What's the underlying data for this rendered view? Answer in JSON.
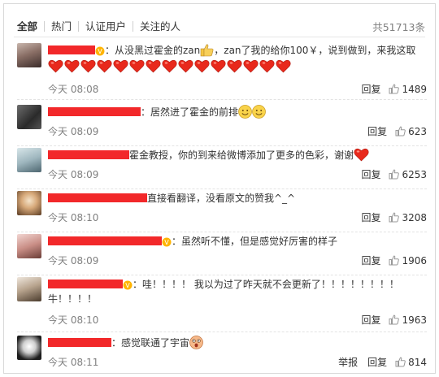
{
  "tabs": [
    "全部",
    "热门",
    "认证用户",
    "关注的人"
  ],
  "total": "共51713条",
  "actions": {
    "report": "举报",
    "reply": "回复"
  },
  "colors": {
    "redaction": "#f2282a",
    "heart": "#e8291c",
    "like_icon": "#999999"
  },
  "comments": [
    {
      "name_redacted": true,
      "pre": "：从没黑过霍金的zan",
      "mid": "，zan了我的给你100￥，说到做到，来我这取",
      "hearts": 15,
      "time": "今天 08:08",
      "likes": "1489",
      "icons": [
        "thumbs-up-emoji",
        "heart-emoji"
      ]
    },
    {
      "name_redacted": true,
      "pre": "：居然进了霍金的前排",
      "time": "今天 08:09",
      "likes": "623",
      "icons": [
        "smile-emoji"
      ]
    },
    {
      "name_redacted": true,
      "pre": "霍金教授，你的到来给微博添加了更多的色彩，谢谢",
      "time": "今天 08:09",
      "likes": "6253",
      "icons": [
        "heart-emoji"
      ]
    },
    {
      "name_redacted": true,
      "pre": "直接看翻译，没看原文的赞我^_^",
      "time": "今天 08:10",
      "likes": "3208"
    },
    {
      "name_redacted": true,
      "pre": "：虽然听不懂，但是感觉好厉害的样子",
      "time": "今天 08:09",
      "likes": "1906"
    },
    {
      "name_redacted": true,
      "pre": "：哇！！！！ 我以为过了昨天就不会更新了！！！！！！！！",
      "line2": "牛！！！！",
      "time": "今天 08:10",
      "likes": "1963"
    },
    {
      "name_redacted": true,
      "pre": "：感觉联通了宇宙",
      "time": "今天 08:11",
      "likes": "814",
      "icons": [
        "surprised-emoji"
      ]
    }
  ]
}
